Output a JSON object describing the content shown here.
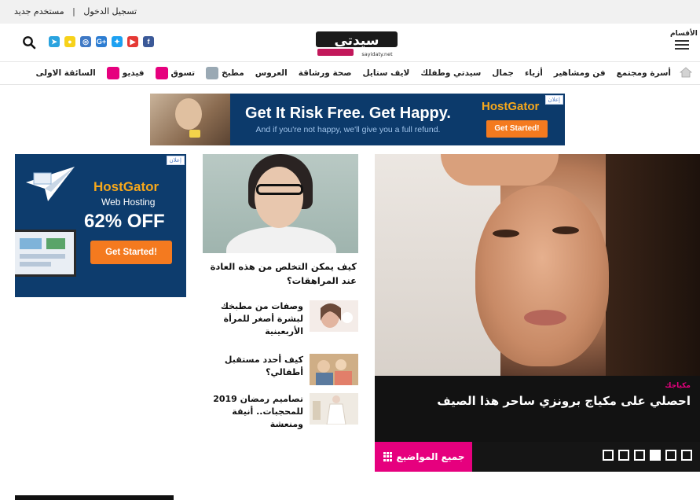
{
  "topbar": {
    "login": "تسجيل الدخول",
    "separator": "|",
    "register": "مستخدم جديد"
  },
  "header": {
    "logo_text": "سيدتي",
    "logo_sub": "sayidaty.net",
    "menu_label": "الأقسام",
    "socials": [
      {
        "name": "telegram-icon",
        "glyph": "➤",
        "color": "#2aa3df"
      },
      {
        "name": "snapchat-icon",
        "glyph": "●",
        "color": "#f7d21a"
      },
      {
        "name": "instagram-icon",
        "glyph": "◎",
        "color": "#3f79c5"
      },
      {
        "name": "google-plus-icon",
        "glyph": "G+",
        "color": "#2d7dd2"
      },
      {
        "name": "twitter-icon",
        "glyph": "✦",
        "color": "#1da1f2"
      },
      {
        "name": "youtube-icon",
        "glyph": "▶",
        "color": "#e53935"
      },
      {
        "name": "facebook-icon",
        "glyph": "f",
        "color": "#3b5998"
      }
    ]
  },
  "nav": {
    "items": [
      {
        "label": "أسرة ومجتمع"
      },
      {
        "label": "فن ومشاهير"
      },
      {
        "label": "أزياء"
      },
      {
        "label": "جمال"
      },
      {
        "label": "سيدتي وطفلك"
      },
      {
        "label": "لايف ستايل"
      },
      {
        "label": "صحة ورشاقة"
      },
      {
        "label": "العروس"
      },
      {
        "label": "مطبخ",
        "icon": "kitchen-icon",
        "icon_color": "#9aa9b4"
      },
      {
        "label": "تسوق",
        "icon": "shop-icon",
        "icon_color": "#e6007e"
      },
      {
        "label": "فيديو",
        "icon": "tv-icon",
        "icon_color": "#e6007e"
      },
      {
        "label": "السائقة الاولى"
      }
    ]
  },
  "top_ad": {
    "tag": "إعلان",
    "headline": "Get It Risk Free. Get Happy.",
    "sub": "And if you're not happy, we'll give you a full refund.",
    "brand": "HostGator",
    "cta": "Get Started!"
  },
  "side_ad": {
    "tag": "إعلان",
    "brand": "HostGator",
    "service": "Web Hosting",
    "offer": "62% OFF",
    "cta": "Get Started!"
  },
  "feature": {
    "title": "كيف يمكن التخلص من هذه العادة عند المراهقات؟"
  },
  "articles": [
    {
      "title": "وصفات من مطبخك لبشرة أصغر للمرأة الأربعينية",
      "thumb_color": "#d8a99a"
    },
    {
      "title": "كيف أحدد مستقبل أطفالي؟",
      "thumb_color": "#b99670"
    },
    {
      "title": "تصاميم رمضان 2019 للمحجبات.. أنيقة ومنعشة",
      "thumb_color": "#e9e3d8"
    }
  ],
  "hero": {
    "category": "مكياجك",
    "caption": "احصلي على مكياج برونزي ساحر هذا الصيف",
    "all_topics": "جميع المواضيع",
    "slides": [
      {
        "active": false
      },
      {
        "active": false
      },
      {
        "active": false
      },
      {
        "active": true
      },
      {
        "active": false
      },
      {
        "active": false
      }
    ]
  }
}
